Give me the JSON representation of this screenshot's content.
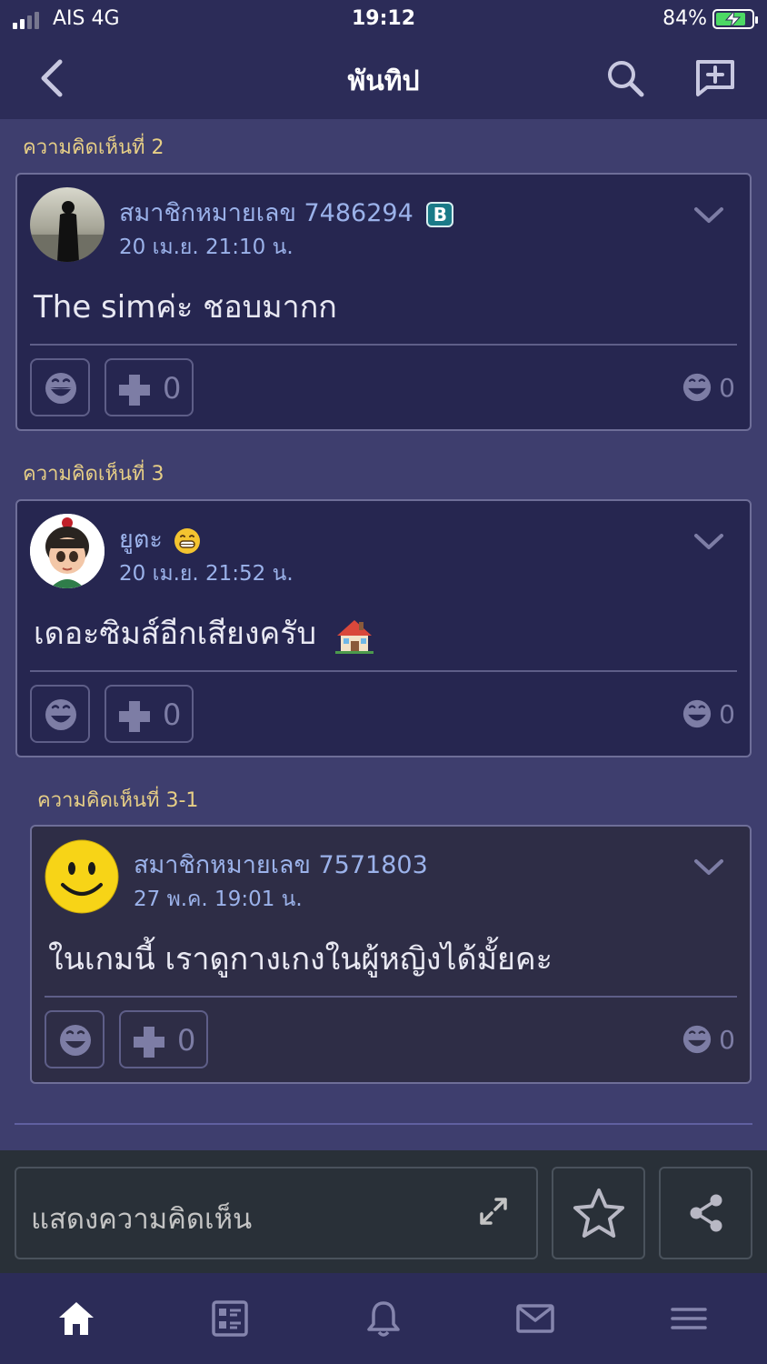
{
  "status_bar": {
    "carrier": "AIS  4G",
    "time": "19:12",
    "battery": "84%"
  },
  "header": {
    "title": "พันทิป"
  },
  "comments": [
    {
      "label": "ความคิดเห็นที่ 2",
      "username": "สมาชิกหมายเลข 7486294",
      "badge": "B",
      "time": "20 เม.ย. 21:10 น.",
      "content": "The simค่ะ ชอบมากก",
      "plus_count": "0",
      "reaction_count": "0"
    },
    {
      "label": "ความคิดเห็นที่ 3",
      "username": "ยูตะ",
      "time": "20 เม.ย. 21:52 น.",
      "content": "เดอะซิมส์อีกเสียงครับ",
      "plus_count": "0",
      "reaction_count": "0"
    },
    {
      "label": "ความคิดเห็นที่ 3-1",
      "username": "สมาชิกหมายเลข 7571803",
      "time": "27 พ.ค. 19:01 น.",
      "content": "ในเกมนี้ เราดูกางเกงในผู้หญิงได้มั้ยคะ",
      "plus_count": "0",
      "reaction_count": "0"
    }
  ],
  "compose": {
    "placeholder": "แสดงความคิดเห็น"
  },
  "tabs": [
    "home-icon",
    "feed-icon",
    "bell-icon",
    "mail-icon",
    "menu-icon"
  ],
  "colors": {
    "accent_label": "#e7cf86",
    "username": "#9bb2ea",
    "header_bg": "#2c2c58",
    "page_bg": "#3e3e6e"
  }
}
